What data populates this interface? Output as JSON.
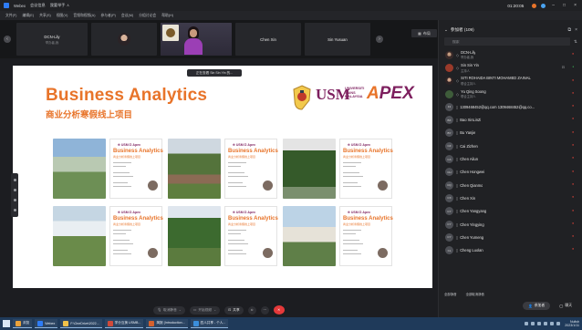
{
  "window": {
    "app_name": "Webex",
    "tabs": [
      "会议信息",
      "我要举手 ㅅ"
    ],
    "time": "01:20:05",
    "colors": {
      "accent": "#2e7cf6",
      "recording": "#e8742a",
      "leave": "#e5393a"
    }
  },
  "menubar": {
    "items": [
      "文件(F)",
      "编辑(E)",
      "共享(S)",
      "视图(V)",
      "音频和视频(A)",
      "参与者(P)",
      "会议(M)",
      "分组讨论会",
      "帮助(H)"
    ]
  },
  "videostrip": {
    "tiles": [
      {
        "name": "DCN-Lily",
        "sub": "举办者,我"
      },
      {
        "name": "",
        "sub": ""
      },
      {
        "name": "",
        "sub": ""
      },
      {
        "name": "Chen Xin",
        "sub": ""
      },
      {
        "name": "Sin Yusuan",
        "sub": ""
      }
    ],
    "layout_label": "布局"
  },
  "share": {
    "badge": "正在查看 Sin Sin Yin 的...",
    "slide": {
      "title": "Business Analytics",
      "subtitle": "商业分析寒假线上项目",
      "usm": "USM",
      "usm_sub": "UNIVERSITI SAINS MALAYSIA",
      "apex_a": "A",
      "apex_rest": "PEX",
      "poster_logo": "⊕ USM ⊡ Apex",
      "poster_title": "Business Analytics",
      "poster_cn": "商业分析寒假线上项目"
    }
  },
  "controls": {
    "mute": "取消静音",
    "video": "开始视频",
    "share": "共享"
  },
  "panel": {
    "title": "参加者 (109)",
    "search_placeholder": "搜索",
    "participants": [
      {
        "initials": "",
        "name": "DCN-Lily",
        "role": "举办者,我"
      },
      {
        "initials": "",
        "name": "Sin Sin Yin",
        "role": "主持人"
      },
      {
        "initials": "",
        "name": "SITI ROHAIDA BINTI MOHAMED ZAINAL",
        "role": "联合主持人"
      },
      {
        "initials": "",
        "name": "Yu Qing Soong",
        "role": "联合主持人"
      },
      {
        "initials": "13",
        "name": "1309468452@qq.com 1309468452@qq.co...",
        "role": ""
      },
      {
        "initials": "BX",
        "name": "Bao XinLinZi",
        "role": ""
      },
      {
        "initials": "BY",
        "name": "Bu Yanjie",
        "role": ""
      },
      {
        "initials": "CZ",
        "name": "Cai Zizhen",
        "role": ""
      },
      {
        "initials": "CA",
        "name": "Chen Ailun",
        "role": ""
      },
      {
        "initials": "CH",
        "name": "Chen Hongwei",
        "role": ""
      },
      {
        "initials": "CQ",
        "name": "Chen Qianmo",
        "role": ""
      },
      {
        "initials": "CX",
        "name": "Chen Xin",
        "role": ""
      },
      {
        "initials": "CY",
        "name": "Chen Yangyang",
        "role": ""
      },
      {
        "initials": "CY",
        "name": "Chen Yingying",
        "role": ""
      },
      {
        "initials": "CY",
        "name": "Chen Yumeng",
        "role": ""
      },
      {
        "initials": "CL",
        "name": "Cheng Luolan",
        "role": ""
      }
    ],
    "footer": [
      "全部静音",
      "全部取消静音"
    ],
    "btn_participants": "参加者",
    "btn_chat": "聊天"
  },
  "taskbar": {
    "tasks": [
      "浏览",
      "Webex",
      "F:\\OneDrive\\2022...",
      "学分互换 USMB...",
      "简报 (Introduction...",
      "四人共享 - 个人..."
    ],
    "clock_time": "Nulish",
    "clock_date": "2023/1/11"
  }
}
